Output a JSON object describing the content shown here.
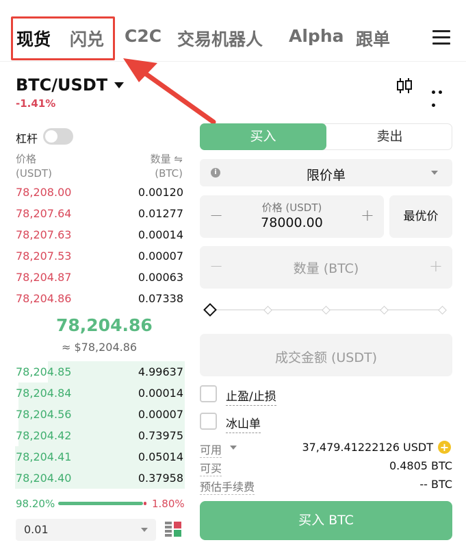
{
  "nav": {
    "tabs": [
      "现货",
      "闪兑",
      "C2C",
      "交易机器人",
      "Alpha",
      "跟单"
    ],
    "active_tab": "现货"
  },
  "pair": {
    "symbol": "BTC/USDT",
    "change": "-1.41%"
  },
  "leverage": {
    "label": "杠杆",
    "enabled": false
  },
  "orderbook": {
    "price_header": "价格",
    "price_unit": "(USDT)",
    "qty_header": "数量 ⇋",
    "qty_unit": "(BTC)",
    "asks": [
      {
        "price": "78,208.00",
        "qty": "0.00120"
      },
      {
        "price": "78,207.64",
        "qty": "0.01277"
      },
      {
        "price": "78,207.63",
        "qty": "0.00014"
      },
      {
        "price": "78,207.53",
        "qty": "0.00007"
      },
      {
        "price": "78,204.87",
        "qty": "0.00063"
      },
      {
        "price": "78,204.86",
        "qty": "0.07338"
      }
    ],
    "last_price": "78,204.86",
    "last_price_fiat": "≈ $78,204.86",
    "bids": [
      {
        "price": "78,204.85",
        "qty": "4.99637",
        "depth": 0.74
      },
      {
        "price": "78,204.84",
        "qty": "0.00014",
        "depth": 0.9
      },
      {
        "price": "78,204.56",
        "qty": "0.00007",
        "depth": 0.9
      },
      {
        "price": "78,204.42",
        "qty": "0.73975",
        "depth": 0.9
      },
      {
        "price": "78,204.41",
        "qty": "0.05014",
        "depth": 0.92
      },
      {
        "price": "78,204.40",
        "qty": "0.37958",
        "depth": 0.92
      }
    ],
    "buy_ratio": "98.20%",
    "sell_ratio": "1.80%",
    "precision": "0.01"
  },
  "trade": {
    "buy_tab": "买入",
    "sell_tab": "卖出",
    "order_type": "限价单",
    "price_label": "价格 (USDT)",
    "price_value": "78000.00",
    "best_price_button": "最优价",
    "qty_placeholder": "数量 (BTC)",
    "amount_placeholder": "成交金额 (USDT)",
    "tp_sl_label": "止盈/止损",
    "iceberg_label": "冰山单",
    "available_label": "可用",
    "available_value": "37,479.41222126 USDT",
    "can_buy_label": "可买",
    "can_buy_value": "0.4805 BTC",
    "fee_label": "预估手续费",
    "fee_value": "-- BTC",
    "buy_button": "买入 BTC"
  },
  "colors": {
    "buy_green": "#65bf87",
    "sell_red": "#d9485a",
    "annotation_red": "#e8443a"
  }
}
